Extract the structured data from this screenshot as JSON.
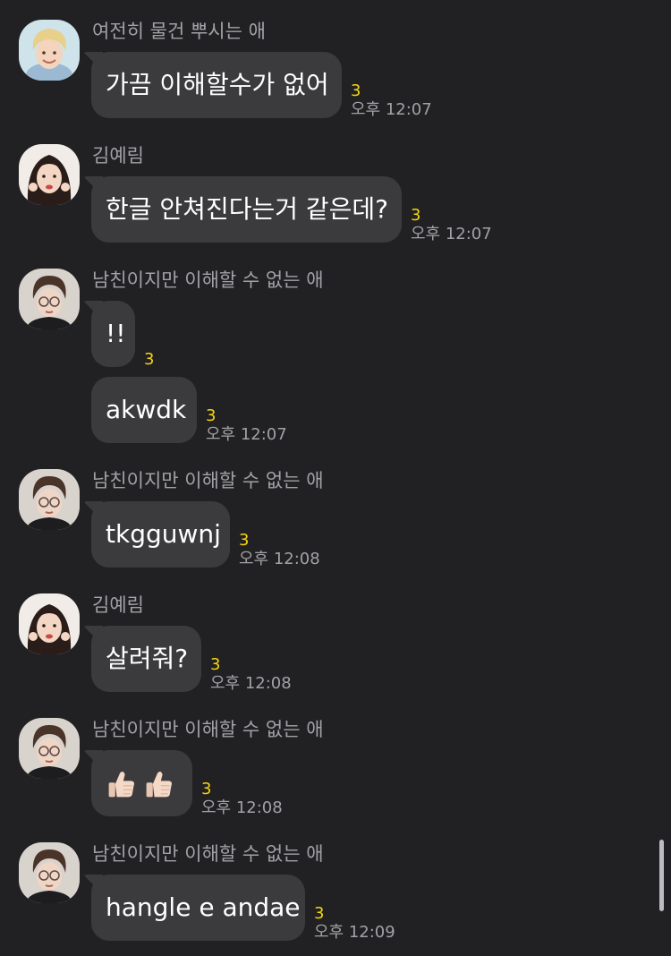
{
  "messages": [
    {
      "sender": "여전히 물건 뿌시는 애",
      "avatar": "avatar-boy-blond",
      "text": "가끔 이해할수가 없어",
      "unread": "3",
      "time": "오후 12:07"
    },
    {
      "sender": "김예림",
      "avatar": "avatar-girl",
      "text": "한글 안쳐진다는거 같은데?",
      "unread": "3",
      "time": "오후 12:07"
    },
    {
      "sender": "남친이지만 이해할 수 없는 애",
      "avatar": "avatar-boy-glasses",
      "text1": "!!",
      "unread1": "3",
      "text2": "akwdk",
      "unread2": "3",
      "time": "오후 12:07"
    },
    {
      "sender": "남친이지만 이해할 수 없는 애",
      "avatar": "avatar-boy-glasses",
      "text": "tkgguwnj",
      "unread": "3",
      "time": "오후 12:08"
    },
    {
      "sender": "김예림",
      "avatar": "avatar-girl",
      "text": "살려줘?",
      "unread": "3",
      "time": "오후 12:08"
    },
    {
      "sender": "남친이지만 이해할 수 없는 애",
      "avatar": "avatar-boy-glasses",
      "emoji": "thumbs-up-icon",
      "unread": "3",
      "time": "오후 12:08"
    },
    {
      "sender": "남친이지만 이해할 수 없는 애",
      "avatar": "avatar-boy-glasses",
      "text": "hangle e andae",
      "unread": "3",
      "time": "오후 12:09"
    }
  ],
  "colors": {
    "background": "#212124",
    "bubble": "#3b3b3e",
    "unread": "#f5d40f",
    "meta_text": "#a2a2a6"
  }
}
